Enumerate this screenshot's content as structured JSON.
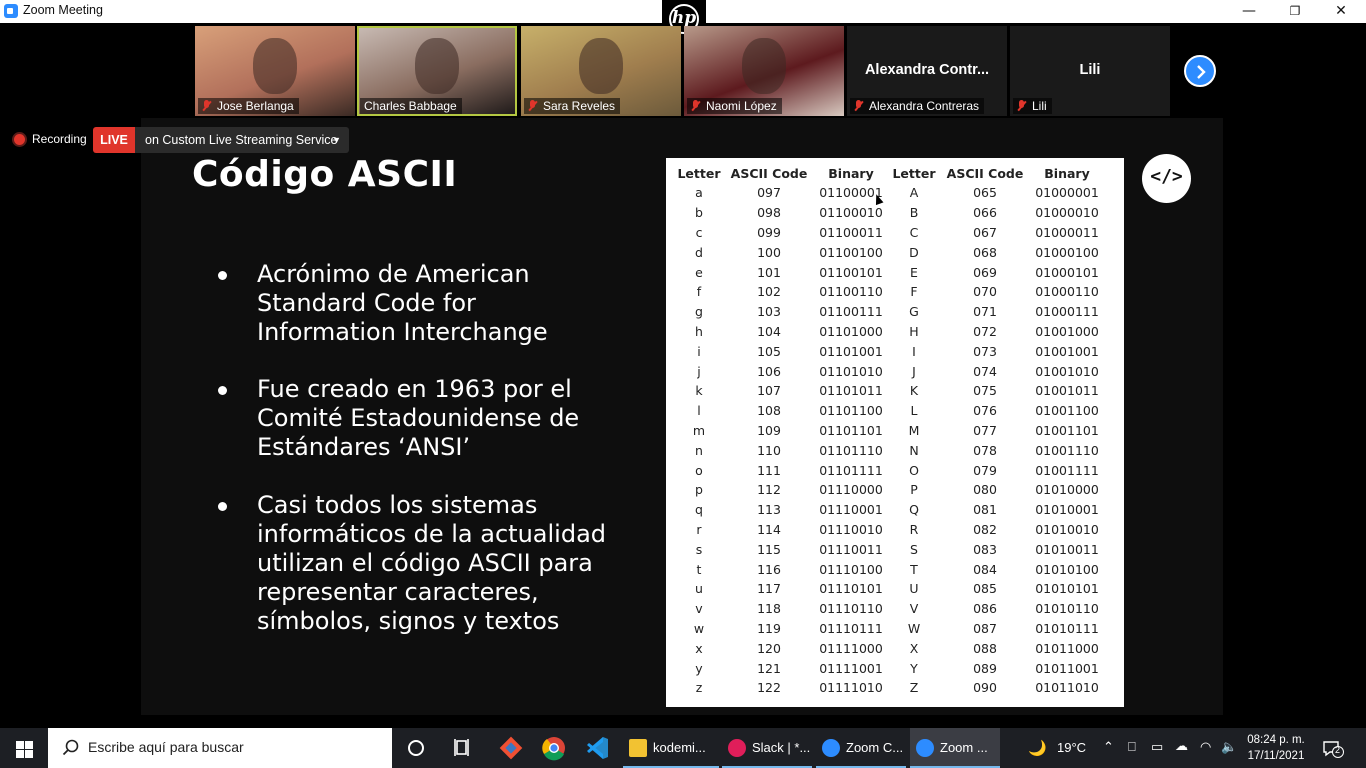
{
  "window": {
    "title": "Zoom Meeting",
    "minimize": "—",
    "restore": "❐",
    "close": "✕"
  },
  "hp_logo": "hp",
  "participants": [
    {
      "name": "Jose Berlanga",
      "muted": true,
      "video": true,
      "colors": [
        "#d8a07a",
        "#b2705b",
        "#3a2a24"
      ]
    },
    {
      "name": "Charles Babbage",
      "muted": false,
      "video": true,
      "active": true,
      "colors": [
        "#c9bcb5",
        "#8a6d60",
        "#1b1717"
      ]
    },
    {
      "name": "Sara Reveles",
      "muted": true,
      "video": true,
      "colors": [
        "#c7b06a",
        "#a07e4e",
        "#6c5a3b"
      ]
    },
    {
      "name": "Naomi López",
      "muted": true,
      "video": true,
      "colors": [
        "#b89a8a",
        "#5d1a1e",
        "#d8c9c0"
      ]
    },
    {
      "name": "Alexandra Contreras",
      "display_name": "Alexandra  Contr...",
      "muted": true,
      "video": false
    },
    {
      "name": "Lili",
      "display_name": "Lili",
      "muted": true,
      "video": false
    }
  ],
  "recording": {
    "label": "Recording",
    "live_badge": "LIVE",
    "stream_service": "on Custom Live Streaming Service"
  },
  "slide": {
    "title": "Código  ASCII",
    "bullets": [
      "Acrónimo de American Standard Code for Information Interchange",
      "Fue creado en 1963 por el Comité Estadounidense de Estándares ‘ANSI’",
      "Casi todos los sistemas informáticos de la actualidad utilizan el código ASCII para representar caracteres, símbolos, signos y textos"
    ],
    "code_icon": "</>"
  },
  "ascii_table": {
    "headers": [
      "Letter",
      "ASCII Code",
      "Binary",
      "Letter",
      "ASCII Code",
      "Binary"
    ],
    "rows": [
      [
        "a",
        "097",
        "01100001",
        "A",
        "065",
        "01000001"
      ],
      [
        "b",
        "098",
        "01100010",
        "B",
        "066",
        "01000010"
      ],
      [
        "c",
        "099",
        "01100011",
        "C",
        "067",
        "01000011"
      ],
      [
        "d",
        "100",
        "01100100",
        "D",
        "068",
        "01000100"
      ],
      [
        "e",
        "101",
        "01100101",
        "E",
        "069",
        "01000101"
      ],
      [
        "f",
        "102",
        "01100110",
        "F",
        "070",
        "01000110"
      ],
      [
        "g",
        "103",
        "01100111",
        "G",
        "071",
        "01000111"
      ],
      [
        "h",
        "104",
        "01101000",
        "H",
        "072",
        "01001000"
      ],
      [
        "i",
        "105",
        "01101001",
        "I",
        "073",
        "01001001"
      ],
      [
        "j",
        "106",
        "01101010",
        "J",
        "074",
        "01001010"
      ],
      [
        "k",
        "107",
        "01101011",
        "K",
        "075",
        "01001011"
      ],
      [
        "l",
        "108",
        "01101100",
        "L",
        "076",
        "01001100"
      ],
      [
        "m",
        "109",
        "01101101",
        "M",
        "077",
        "01001101"
      ],
      [
        "n",
        "110",
        "01101110",
        "N",
        "078",
        "01001110"
      ],
      [
        "o",
        "111",
        "01101111",
        "O",
        "079",
        "01001111"
      ],
      [
        "p",
        "112",
        "01110000",
        "P",
        "080",
        "01010000"
      ],
      [
        "q",
        "113",
        "01110001",
        "Q",
        "081",
        "01010001"
      ],
      [
        "r",
        "114",
        "01110010",
        "R",
        "082",
        "01010010"
      ],
      [
        "s",
        "115",
        "01110011",
        "S",
        "083",
        "01010011"
      ],
      [
        "t",
        "116",
        "01110100",
        "T",
        "084",
        "01010100"
      ],
      [
        "u",
        "117",
        "01110101",
        "U",
        "085",
        "01010101"
      ],
      [
        "v",
        "118",
        "01110110",
        "V",
        "086",
        "01010110"
      ],
      [
        "w",
        "119",
        "01110111",
        "W",
        "087",
        "01010111"
      ],
      [
        "x",
        "120",
        "01111000",
        "X",
        "088",
        "01011000"
      ],
      [
        "y",
        "121",
        "01111001",
        "Y",
        "089",
        "01011001"
      ],
      [
        "z",
        "122",
        "01111010",
        "Z",
        "090",
        "01011010"
      ]
    ]
  },
  "taskbar": {
    "search_placeholder": "Escribe aquí para buscar",
    "apps": [
      {
        "label": "kodemi...",
        "icon": "folder-icon",
        "color": "#f2c232"
      },
      {
        "label": "Slack | *...",
        "icon": "slack-icon",
        "color": "#e01e5a"
      },
      {
        "label": "Zoom C...",
        "icon": "zoom-icon",
        "color": "#2d8cff"
      },
      {
        "label": "Zoom ...",
        "icon": "zoom-icon",
        "color": "#2d8cff",
        "active": true
      }
    ],
    "weather": "19°C",
    "time": "08:24 p. m.",
    "date": "17/11/2021",
    "notification_count": "2"
  },
  "accent_colors": {
    "zoom_blue": "#2d8cff",
    "live_red": "#e0352b",
    "active_speaker": "#b4c742"
  }
}
